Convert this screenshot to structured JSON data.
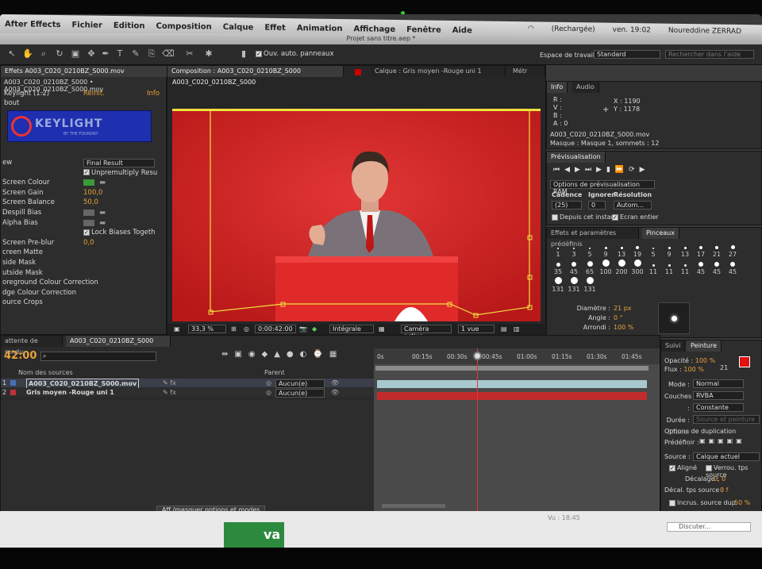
{
  "menubar": {
    "app": "After Effects",
    "items": [
      "Fichier",
      "Edition",
      "Composition",
      "Calque",
      "Effet",
      "Animation",
      "Affichage",
      "Fenêtre",
      "Aide"
    ],
    "battery": "(Rechargée)",
    "clock": "ven. 19:02",
    "user": "Noureddine ZERRAD"
  },
  "window_title": "Projet sans titre.aep *",
  "toolbar": {
    "auto_panels": "Ouv. auto. panneaux",
    "workspace_label": "Espace de travail :",
    "workspace_value": "Standard",
    "help_search_placeholder": "Rechercher dans l'aide"
  },
  "effects_panel": {
    "tab": "Effets A003_C020_0210BZ_S000.mov",
    "breadcrumb": "A003_C020_0210BZ_S000 • A003_C020_0210BZ_S000.mov",
    "effect_name": "Keylight (1.2)",
    "reset": "Réinit.",
    "info": "Info",
    "about": "bout",
    "logo_text": "KEYLIGHT",
    "logo_sub": "BY THE FOUNDRY",
    "rows": [
      {
        "label": "ew",
        "value": "Final Result",
        "kind": "select"
      },
      {
        "label": "",
        "value": "Unpremultiply Resu",
        "kind": "check"
      },
      {
        "label": "Screen Colour",
        "value": "",
        "kind": "color"
      },
      {
        "label": "Screen Gain",
        "value": "100,0",
        "kind": "num"
      },
      {
        "label": "Screen Balance",
        "value": "50,0",
        "kind": "num"
      },
      {
        "label": "Despill Bias",
        "value": "",
        "kind": "swatch"
      },
      {
        "label": "Alpha Bias",
        "value": "",
        "kind": "swatch"
      },
      {
        "label": "",
        "value": "Lock Biases Togeth",
        "kind": "check"
      },
      {
        "label": "Screen Pre-blur",
        "value": "0,0",
        "kind": "num"
      },
      {
        "label": "creen Matte",
        "value": "",
        "kind": "group"
      },
      {
        "label": "side Mask",
        "value": "",
        "kind": "group"
      },
      {
        "label": "utside Mask",
        "value": "",
        "kind": "group"
      },
      {
        "label": "oreground Colour Correction",
        "value": "",
        "kind": "group"
      },
      {
        "label": "dge Colour Correction",
        "value": "",
        "kind": "group"
      },
      {
        "label": "ource Crops",
        "value": "",
        "kind": "group"
      }
    ]
  },
  "comp_panel": {
    "tab": "Composition : A003_C020_0210BZ_S000",
    "layer_tab": "Calque : Gris moyen -Rouge uni 1",
    "flow_tab": "Métr",
    "sub_tab": "A003_C020_0210BZ_S000",
    "zoom": "33,3 %",
    "timecode": "0:00:42:00",
    "resolution": "Intégrale",
    "camera": "Caméra active",
    "views": "1 vue"
  },
  "info_panel": {
    "tab": "Info",
    "tab2": "Audio",
    "r": "R :",
    "v": "V :",
    "b": "B :",
    "a": "A : 0",
    "x": "X : 1190",
    "y": "Y : 1178",
    "file": "A003_C020_0210BZ_S000.mov",
    "mask": "Masque : Masque 1, sommets : 12"
  },
  "preview_panel": {
    "tab": "Prévisualisation",
    "options": "Options de prévisualisation RAM",
    "cadence_label": "Cadence",
    "ignore_label": "Ignorer",
    "res_label": "Résolution",
    "cadence": "(25)",
    "ignore": "0",
    "res": "Autom...",
    "from_current": "Depuis cet instant",
    "fullscreen": "Ecran entier"
  },
  "brushes_panel": {
    "tab1": "Effets et paramètres prédéfinis",
    "tab2": "Pinceaux",
    "brushes": [
      "1",
      "3",
      "5",
      "9",
      "13",
      "19",
      "5",
      "9",
      "13",
      "17",
      "21",
      "27",
      "35",
      "45",
      "65",
      "100",
      "200",
      "300",
      "11",
      "11",
      "11",
      "45",
      "45",
      "45",
      "131",
      "131",
      "131"
    ],
    "diameter_label": "Diamètre :",
    "diameter": "21 px",
    "angle_label": "Angle :",
    "angle": "0 °",
    "round_label": "Arrondi :",
    "round": "100 %"
  },
  "paint_panel": {
    "tab1": "Suivi",
    "tab2": "Peinture",
    "opacity_label": "Opacité :",
    "opacity": "100 %",
    "flow_label": "Flux :",
    "flow": "100 %",
    "brush_size": "21",
    "mode_label": "Mode :",
    "mode": "Normal",
    "channels_label": "Couches :",
    "channels": "RVBA",
    "duration_label": "Durée :",
    "duration": "Constante",
    "erase_label": "Effacer :",
    "erase": "Source et peinture",
    "clone_title": "Options de duplication",
    "preset_label": "Prédéfinir :",
    "source_label": "Source :",
    "source": "Calque actuel",
    "aligned": "Aligné",
    "lock_time": "Verrou. tps source",
    "offset_label": "Décalage :",
    "offset": "0, 0",
    "time_offset_label": "Décal. tps source :",
    "time_offset": "0 f",
    "overlay": "Incrus. source dup.",
    "overlay_pct": "50 %"
  },
  "timeline": {
    "tab_render": "attente de rendu",
    "tab_comp": "A003_C020_0210BZ_S000",
    "timecode": "42:00",
    "col_source": "Nom des sources",
    "col_parent": "Parent",
    "layers": [
      {
        "num": "1",
        "name": "A003_C020_0210BZ_S000.mov",
        "parent": "Aucun(e)",
        "color": "#4a6fb5"
      },
      {
        "num": "2",
        "name": "Gris moyen -Rouge uni 1",
        "parent": "Aucun(e)",
        "color": "#c0303a"
      }
    ],
    "ruler": [
      "0s",
      "00:15s",
      "00:30s",
      "00:45s",
      "01:00s",
      "01:15s",
      "01:30s",
      "01:45s"
    ],
    "toggle_label": "Aff./masquer options et modes"
  },
  "taskbar": {
    "left_text": "va",
    "time_text": "Vu : 18:45",
    "discuss": "Discuter..."
  },
  "colors": {
    "comp_red": "#d42626",
    "accent_orange": "#e8a23a",
    "paint_swatch": "#e01010"
  }
}
